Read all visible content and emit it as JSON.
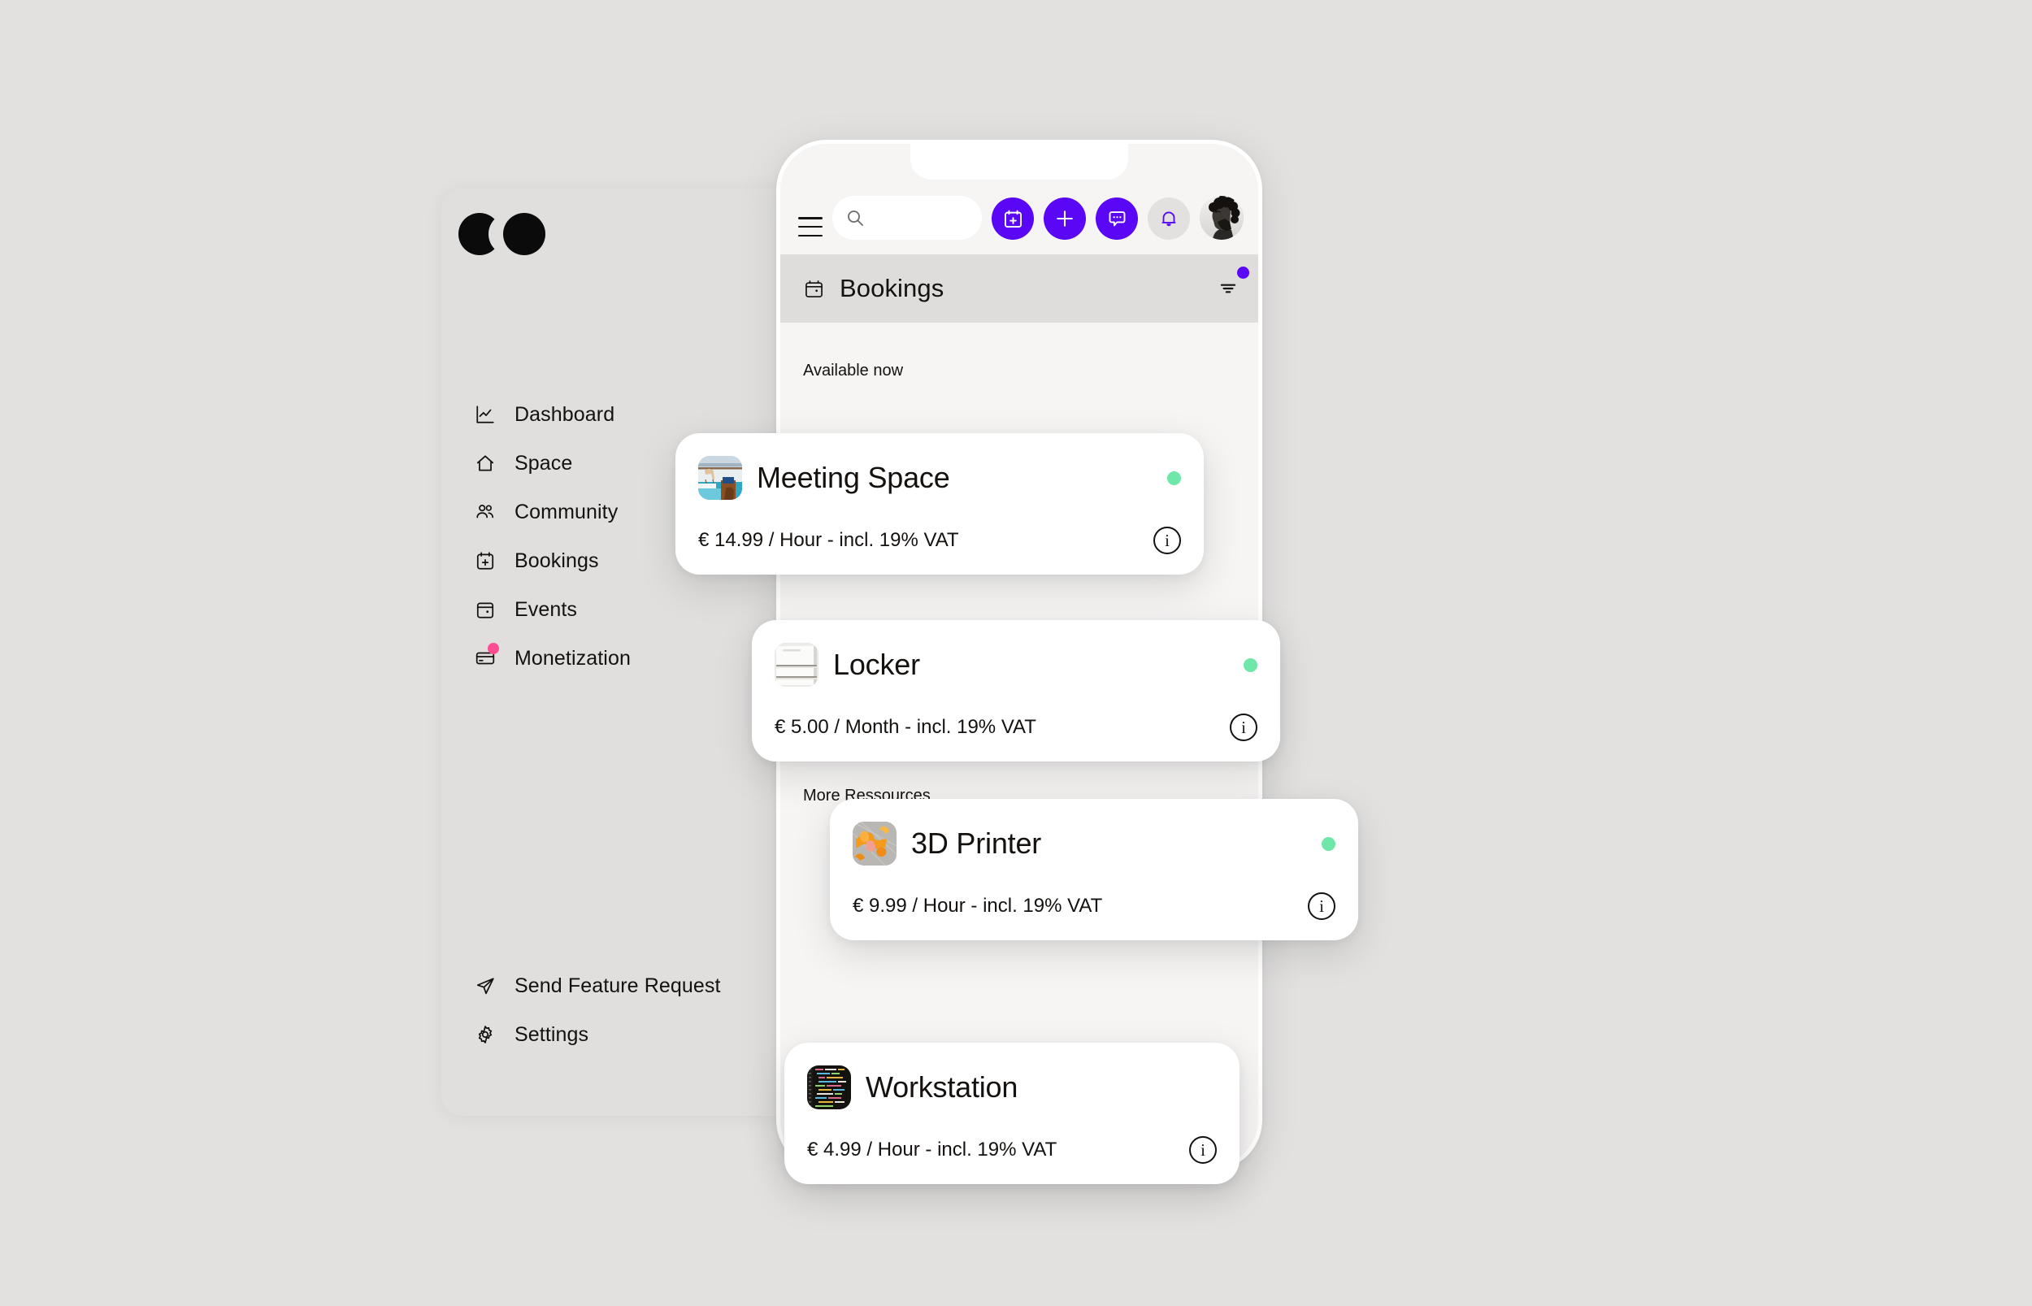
{
  "app": {
    "logo_name": "brand-logo"
  },
  "sidebar": {
    "main_items": [
      {
        "label": "Dashboard",
        "icon": "chart-line-icon",
        "badge": false
      },
      {
        "label": "Space",
        "icon": "home-icon",
        "badge": false
      },
      {
        "label": "Community",
        "icon": "users-icon",
        "badge": false
      },
      {
        "label": "Bookings",
        "icon": "calendar-plus-icon",
        "badge": false
      },
      {
        "label": "Events",
        "icon": "calendar-icon",
        "badge": false
      },
      {
        "label": "Monetization",
        "icon": "credit-card-icon",
        "badge": true
      }
    ],
    "bottom_items": [
      {
        "label": "Send Feature Request",
        "icon": "send-icon"
      },
      {
        "label": "Settings",
        "icon": "gear-icon"
      }
    ],
    "badge_color": "#ff4d94"
  },
  "phone": {
    "topbar": {
      "menu_icon": "hamburger-icon",
      "search": {
        "value": "",
        "placeholder": ""
      },
      "actions": [
        {
          "name": "new-booking-button",
          "icon": "calendar-plus-icon",
          "style": "purple"
        },
        {
          "name": "add-button",
          "icon": "plus-icon",
          "style": "purple"
        },
        {
          "name": "messages-button",
          "icon": "chat-bubble-icon",
          "style": "purple"
        },
        {
          "name": "notifications-button",
          "icon": "bell-icon",
          "style": "grey"
        }
      ],
      "avatar_name": "user-avatar",
      "accent_color": "#5a07f5"
    },
    "header": {
      "icon": "calendar-icon",
      "title": "Bookings",
      "filter_icon": "filter-icon",
      "filter_badge_color": "#5a07f5"
    },
    "sections": [
      {
        "label": "Available now"
      },
      {
        "label": "More Ressources"
      }
    ]
  },
  "resources": [
    {
      "name": "Meeting Space",
      "price": "€ 14.99 / Hour - incl. 19% VAT",
      "status": "available",
      "status_color": "#6ee7a8",
      "thumb": "meeting-space-thumbnail",
      "info_label": "i"
    },
    {
      "name": "Locker",
      "price": "€ 5.00 / Month - incl. 19% VAT",
      "status": "available",
      "status_color": "#6ee7a8",
      "thumb": "locker-thumbnail",
      "info_label": "i"
    },
    {
      "name": "3D Printer",
      "price": "€ 9.99 / Hour - incl. 19% VAT",
      "status": "available",
      "status_color": "#6ee7a8",
      "thumb": "printer-thumbnail",
      "info_label": "i"
    },
    {
      "name": "Workstation",
      "price": "€ 4.99 / Hour - incl. 19% VAT",
      "status": "available",
      "status_color": "#6ee7a8",
      "thumb": "workstation-thumbnail",
      "info_label": "i"
    }
  ]
}
